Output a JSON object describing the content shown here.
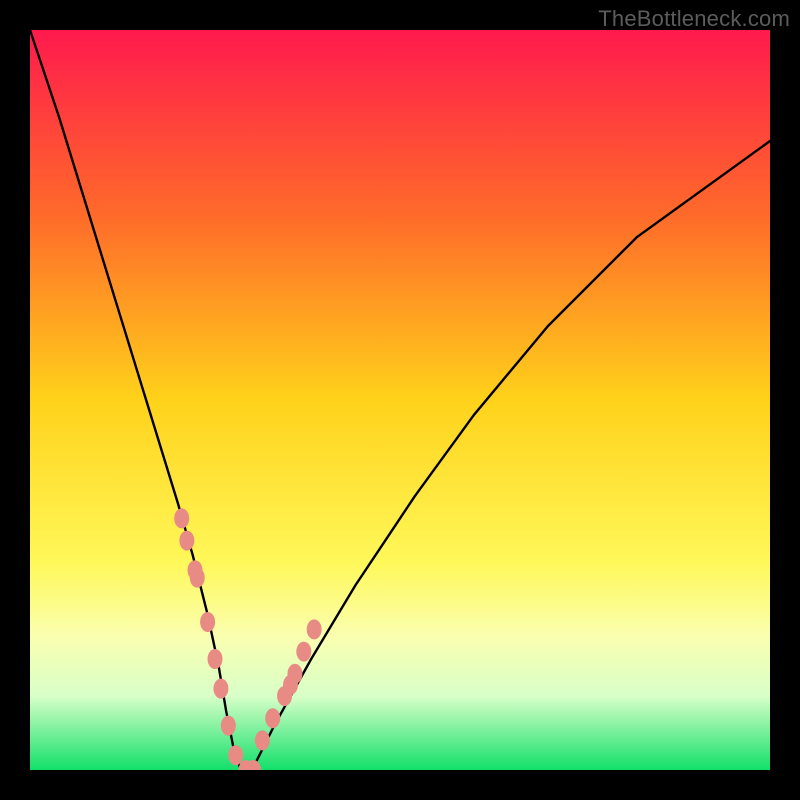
{
  "watermark": "TheBottleneck.com",
  "chart_data": {
    "type": "line",
    "title": "",
    "xlabel": "",
    "ylabel": "",
    "xlim": [
      0,
      100
    ],
    "ylim": [
      0,
      100
    ],
    "gradient_stops": [
      {
        "offset": 0,
        "color": "#ff1a4d"
      },
      {
        "offset": 25,
        "color": "#ff6a2a"
      },
      {
        "offset": 50,
        "color": "#ffd21a"
      },
      {
        "offset": 72,
        "color": "#fff85a"
      },
      {
        "offset": 82,
        "color": "#faffb0"
      },
      {
        "offset": 90,
        "color": "#d8ffc8"
      },
      {
        "offset": 100,
        "color": "#12e06a"
      }
    ],
    "series": [
      {
        "name": "curve",
        "x": [
          0,
          4,
          8,
          12,
          16,
          20,
          22,
          24,
          25.5,
          26.5,
          27.5,
          28.5,
          30,
          33,
          38,
          44,
          52,
          60,
          70,
          82,
          100
        ],
        "values": [
          100,
          88,
          75,
          62,
          49,
          36,
          29,
          21,
          14,
          8,
          3,
          0,
          0,
          6,
          15,
          25,
          37,
          48,
          60,
          72,
          85
        ]
      }
    ],
    "markers": {
      "name": "dots",
      "color": "#e98b85",
      "x": [
        20.5,
        21.2,
        22.3,
        22.6,
        24.0,
        25.0,
        25.8,
        26.8,
        27.8,
        29.2,
        30.2,
        31.4,
        32.8,
        34.4,
        35.2,
        35.8,
        37.0,
        38.4
      ],
      "values": [
        34,
        31,
        27,
        26,
        20,
        15,
        11,
        6,
        2,
        0,
        0,
        4,
        7,
        10,
        11.5,
        13,
        16,
        19
      ]
    }
  }
}
